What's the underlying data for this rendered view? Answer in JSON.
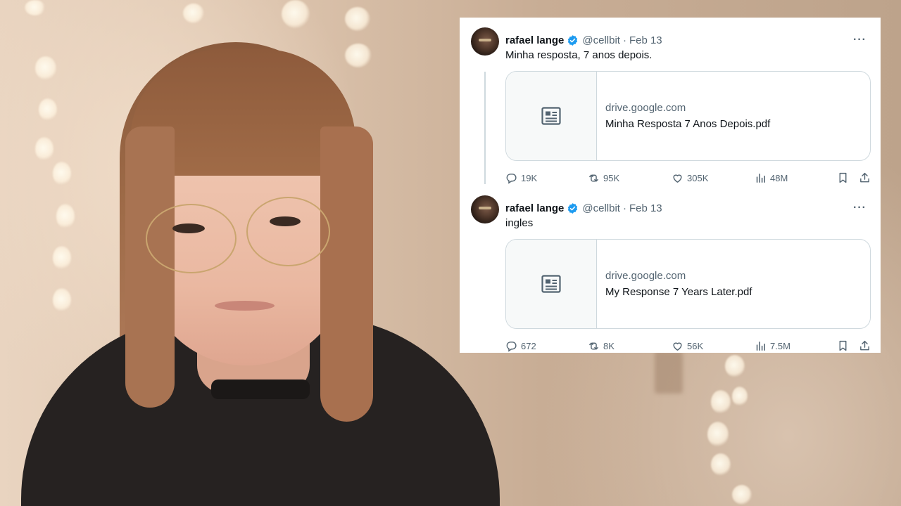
{
  "tweets": [
    {
      "name": "rafael lange",
      "handle": "@cellbit",
      "sep": "·",
      "date": "Feb 13",
      "more": "···",
      "text": "Minha resposta, 7 anos depois.",
      "link": {
        "domain": "drive.google.com",
        "title": "Minha Resposta 7 Anos Depois.pdf"
      },
      "stats": {
        "replies": "19K",
        "reposts": "95K",
        "likes": "305K",
        "views": "48M"
      }
    },
    {
      "name": "rafael lange",
      "handle": "@cellbit",
      "sep": "·",
      "date": "Feb 13",
      "more": "···",
      "text": "ingles",
      "link": {
        "domain": "drive.google.com",
        "title": "My Response 7 Years Later.pdf"
      },
      "stats": {
        "replies": "672",
        "reposts": "8K",
        "likes": "56K",
        "views": "7.5M"
      }
    }
  ],
  "colors": {
    "verified": "#1d9bf0",
    "muted": "#536471",
    "text": "#0f1419",
    "border": "#cfd9de"
  }
}
